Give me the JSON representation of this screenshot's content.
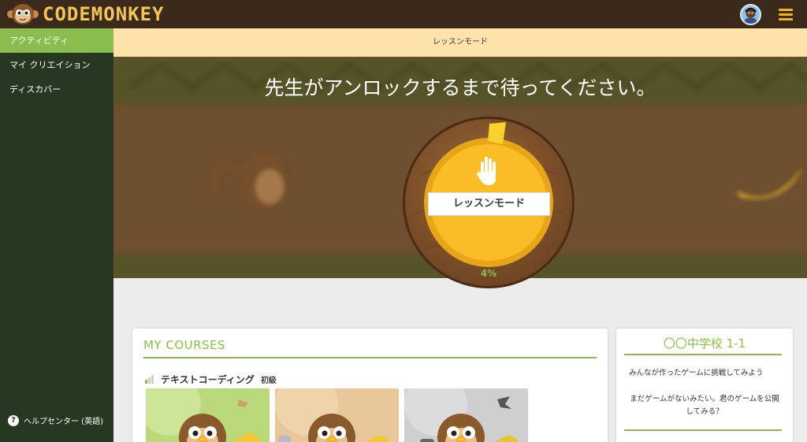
{
  "app": {
    "logo_text": "CODEMONKEY",
    "brand_color": "#f2c45a",
    "topbar_color": "#3b2a1c"
  },
  "sidebar": {
    "items": [
      {
        "label": "アクティビティ",
        "active": true
      },
      {
        "label": "マイ クリエイション",
        "active": false
      },
      {
        "label": "ディスカバー",
        "active": false
      }
    ],
    "help_label": "ヘルプセンター (英語)",
    "bg_color": "#263722",
    "active_color": "#8bbd4e"
  },
  "lesson_bar": {
    "label": "レッスンモード"
  },
  "hero": {
    "title": "先生がアンロックするまで待ってください。",
    "wheel_label": "レッスンモード",
    "progress_text": "4%",
    "progress_fraction": 0.04
  },
  "courses": {
    "title": "MY COURSES",
    "course_name": "テキストコーディング",
    "course_level": "初級"
  },
  "class_panel": {
    "title": "〇〇中学校 1-1",
    "challenge_text": "みんなが作ったゲームに挑戦してみよう",
    "empty_text": "まだゲームがないみたい。君のゲームを公開してみる？"
  }
}
